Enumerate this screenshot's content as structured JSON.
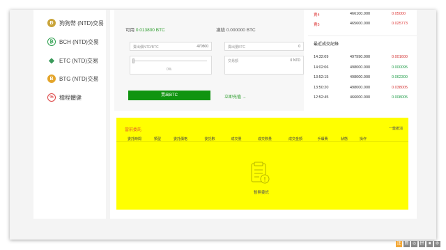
{
  "sidebar": {
    "items": [
      {
        "label": "狗狗幣 (NTD)交易",
        "icon": "dogecoin-icon"
      },
      {
        "label": "BCH (NTD)交易",
        "icon": "bitcoin-cash-icon"
      },
      {
        "label": "ETC (NTD)交易",
        "icon": "ethereum-classic-icon"
      },
      {
        "label": "BTG (NTD)交易",
        "icon": "bitcoin-gold-icon"
      },
      {
        "label": "稽程體健",
        "icon": "percent-icon"
      }
    ]
  },
  "trade": {
    "available_label": "可用",
    "available_value": "0.013800 BTC",
    "frozen_label": "凍結",
    "frozen_value": "0.000000 BTC",
    "sell_price_placeholder": "賣出價NTD/BTC",
    "sell_price_value": "470500",
    "sell_amount_placeholder": "賣出量BTC",
    "sell_amount_value": "0",
    "slider_percent": "0%",
    "trade_amount_label": "交易額",
    "trade_amount_value": "0 NTD",
    "sell_button": "賣出BTC",
    "recharge_link": "立即充值 →"
  },
  "asks": [
    {
      "label": "賣4",
      "price": "466100.000",
      "amount": "0.05000"
    },
    {
      "label": "賣5",
      "price": "465600.000",
      "amount": "0.025773"
    }
  ],
  "recent_trades": {
    "title": "最近成交記錄",
    "rows": [
      {
        "time": "14:32:09",
        "price": "497990.000",
        "amount": "0.001600",
        "color": "#d33333"
      },
      {
        "time": "14:02:06",
        "price": "498000.000",
        "amount": "0.000095",
        "color": "#1c9b45"
      },
      {
        "time": "13:52:15",
        "price": "498000.000",
        "amount": "0.062300",
        "color": "#1c9b45"
      },
      {
        "time": "13:50:20",
        "price": "498000.000",
        "amount": "0.038005",
        "color": "#d33333"
      },
      {
        "time": "12:52:45",
        "price": "466000.000",
        "amount": "0.008005",
        "color": "#1c9b45"
      }
    ]
  },
  "orders": {
    "title": "當前委託",
    "cancel_all": "一鍵撤消",
    "columns": [
      "委託時間",
      "類型",
      "委託價格",
      "委託數",
      "成交量",
      "成交數量",
      "成交金額",
      "手續費",
      "狀態",
      "操作"
    ],
    "empty_text": "暫無委託"
  },
  "toolbar": [
    "注",
    "簡",
    "◎",
    "拼",
    "■",
    "⚙"
  ],
  "colors": {
    "highlight": "#ffff00",
    "sell_button": "#109410",
    "accent_orange": "#e35b2b"
  }
}
